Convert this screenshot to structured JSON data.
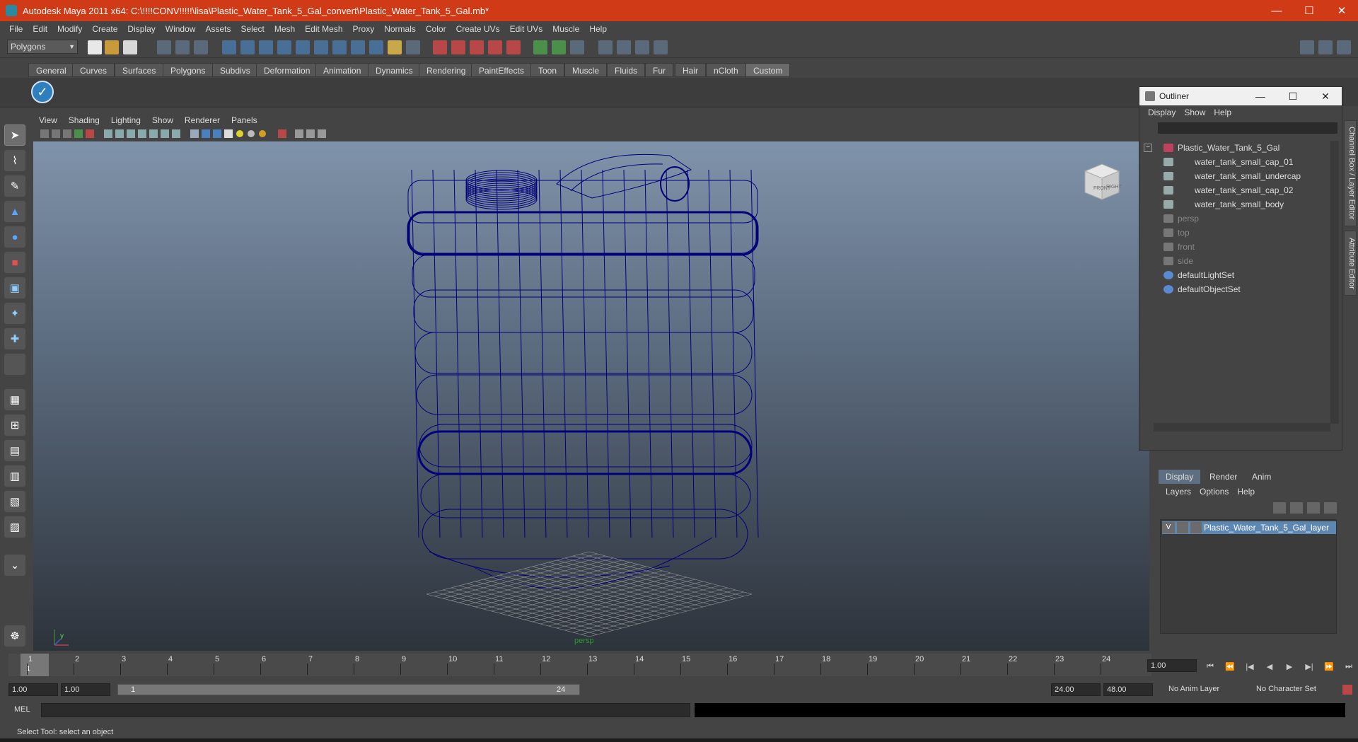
{
  "window": {
    "title": "Autodesk Maya 2011 x64: C:\\!!!!CONV!!!!!\\lisa\\Plastic_Water_Tank_5_Gal_convert\\Plastic_Water_Tank_5_Gal.mb*",
    "minimize": "—",
    "maximize": "☐",
    "close": "✕"
  },
  "menu": [
    "File",
    "Edit",
    "Modify",
    "Create",
    "Display",
    "Window",
    "Assets",
    "Select",
    "Mesh",
    "Edit Mesh",
    "Proxy",
    "Normals",
    "Color",
    "Create UVs",
    "Edit UVs",
    "Muscle",
    "Help"
  ],
  "mode_selector": {
    "value": "Polygons",
    "arrow": "▼"
  },
  "shelf_tabs": [
    "General",
    "Curves",
    "Surfaces",
    "Polygons",
    "Subdivs",
    "Deformation",
    "Animation",
    "Dynamics",
    "Rendering",
    "PaintEffects",
    "Toon",
    "Muscle",
    "Fluids",
    "Fur",
    "Hair",
    "nCloth",
    "Custom"
  ],
  "shelf_active": "Custom",
  "shelf_button_icon": "✓",
  "panel_menu": [
    "View",
    "Shading",
    "Lighting",
    "Show",
    "Renderer",
    "Panels"
  ],
  "viewport": {
    "camera_label": "persp",
    "viewcube_front": "FRONT",
    "viewcube_right": "RIGHT",
    "axis_y": "y",
    "wire_color": "#00007a"
  },
  "outliner": {
    "title": "Outliner",
    "menu": [
      "Display",
      "Show",
      "Help"
    ],
    "items": [
      {
        "label": "Plastic_Water_Tank_5_Gal"
      },
      {
        "label": "water_tank_small_cap_01"
      },
      {
        "label": "water_tank_small_undercap"
      },
      {
        "label": "water_tank_small_cap_02"
      },
      {
        "label": "water_tank_small_body"
      },
      {
        "label": "persp"
      },
      {
        "label": "top"
      },
      {
        "label": "front"
      },
      {
        "label": "side"
      },
      {
        "label": "defaultLightSet"
      },
      {
        "label": "defaultObjectSet"
      }
    ],
    "collapse_icon": "−"
  },
  "side_tabs": [
    "Channel Box / Layer Editor",
    "Attribute Editor"
  ],
  "layer_editor": {
    "tabs": [
      "Display",
      "Render",
      "Anim"
    ],
    "menu": [
      "Layers",
      "Options",
      "Help"
    ],
    "layer": {
      "visible": "V",
      "name": "Plastic_Water_Tank_5_Gal_layer"
    }
  },
  "time_slider": {
    "ticks": [
      "1",
      "2",
      "3",
      "4",
      "5",
      "6",
      "7",
      "8",
      "9",
      "10",
      "11",
      "12",
      "13",
      "14",
      "15",
      "16",
      "17",
      "18",
      "19",
      "20",
      "21",
      "22",
      "23",
      "24"
    ],
    "current": "1",
    "frame_field": "1.00",
    "playback": [
      "⏮",
      "⏪",
      "|◀",
      "◀",
      "▶",
      "▶|",
      "⏩",
      "⏭"
    ]
  },
  "range_slider": {
    "start": "1.00",
    "inner_start": "1.00",
    "bar_start": "1",
    "bar_end": "24",
    "end": "24.00",
    "outer_end": "48.00",
    "anim_layer": "No Anim Layer",
    "char_set": "No Character Set"
  },
  "command_line": {
    "label": "MEL"
  },
  "help_line": "Select Tool: select an object",
  "colors": {
    "titlebar": "#d13a16",
    "selected_layer": "#5d87b3"
  }
}
